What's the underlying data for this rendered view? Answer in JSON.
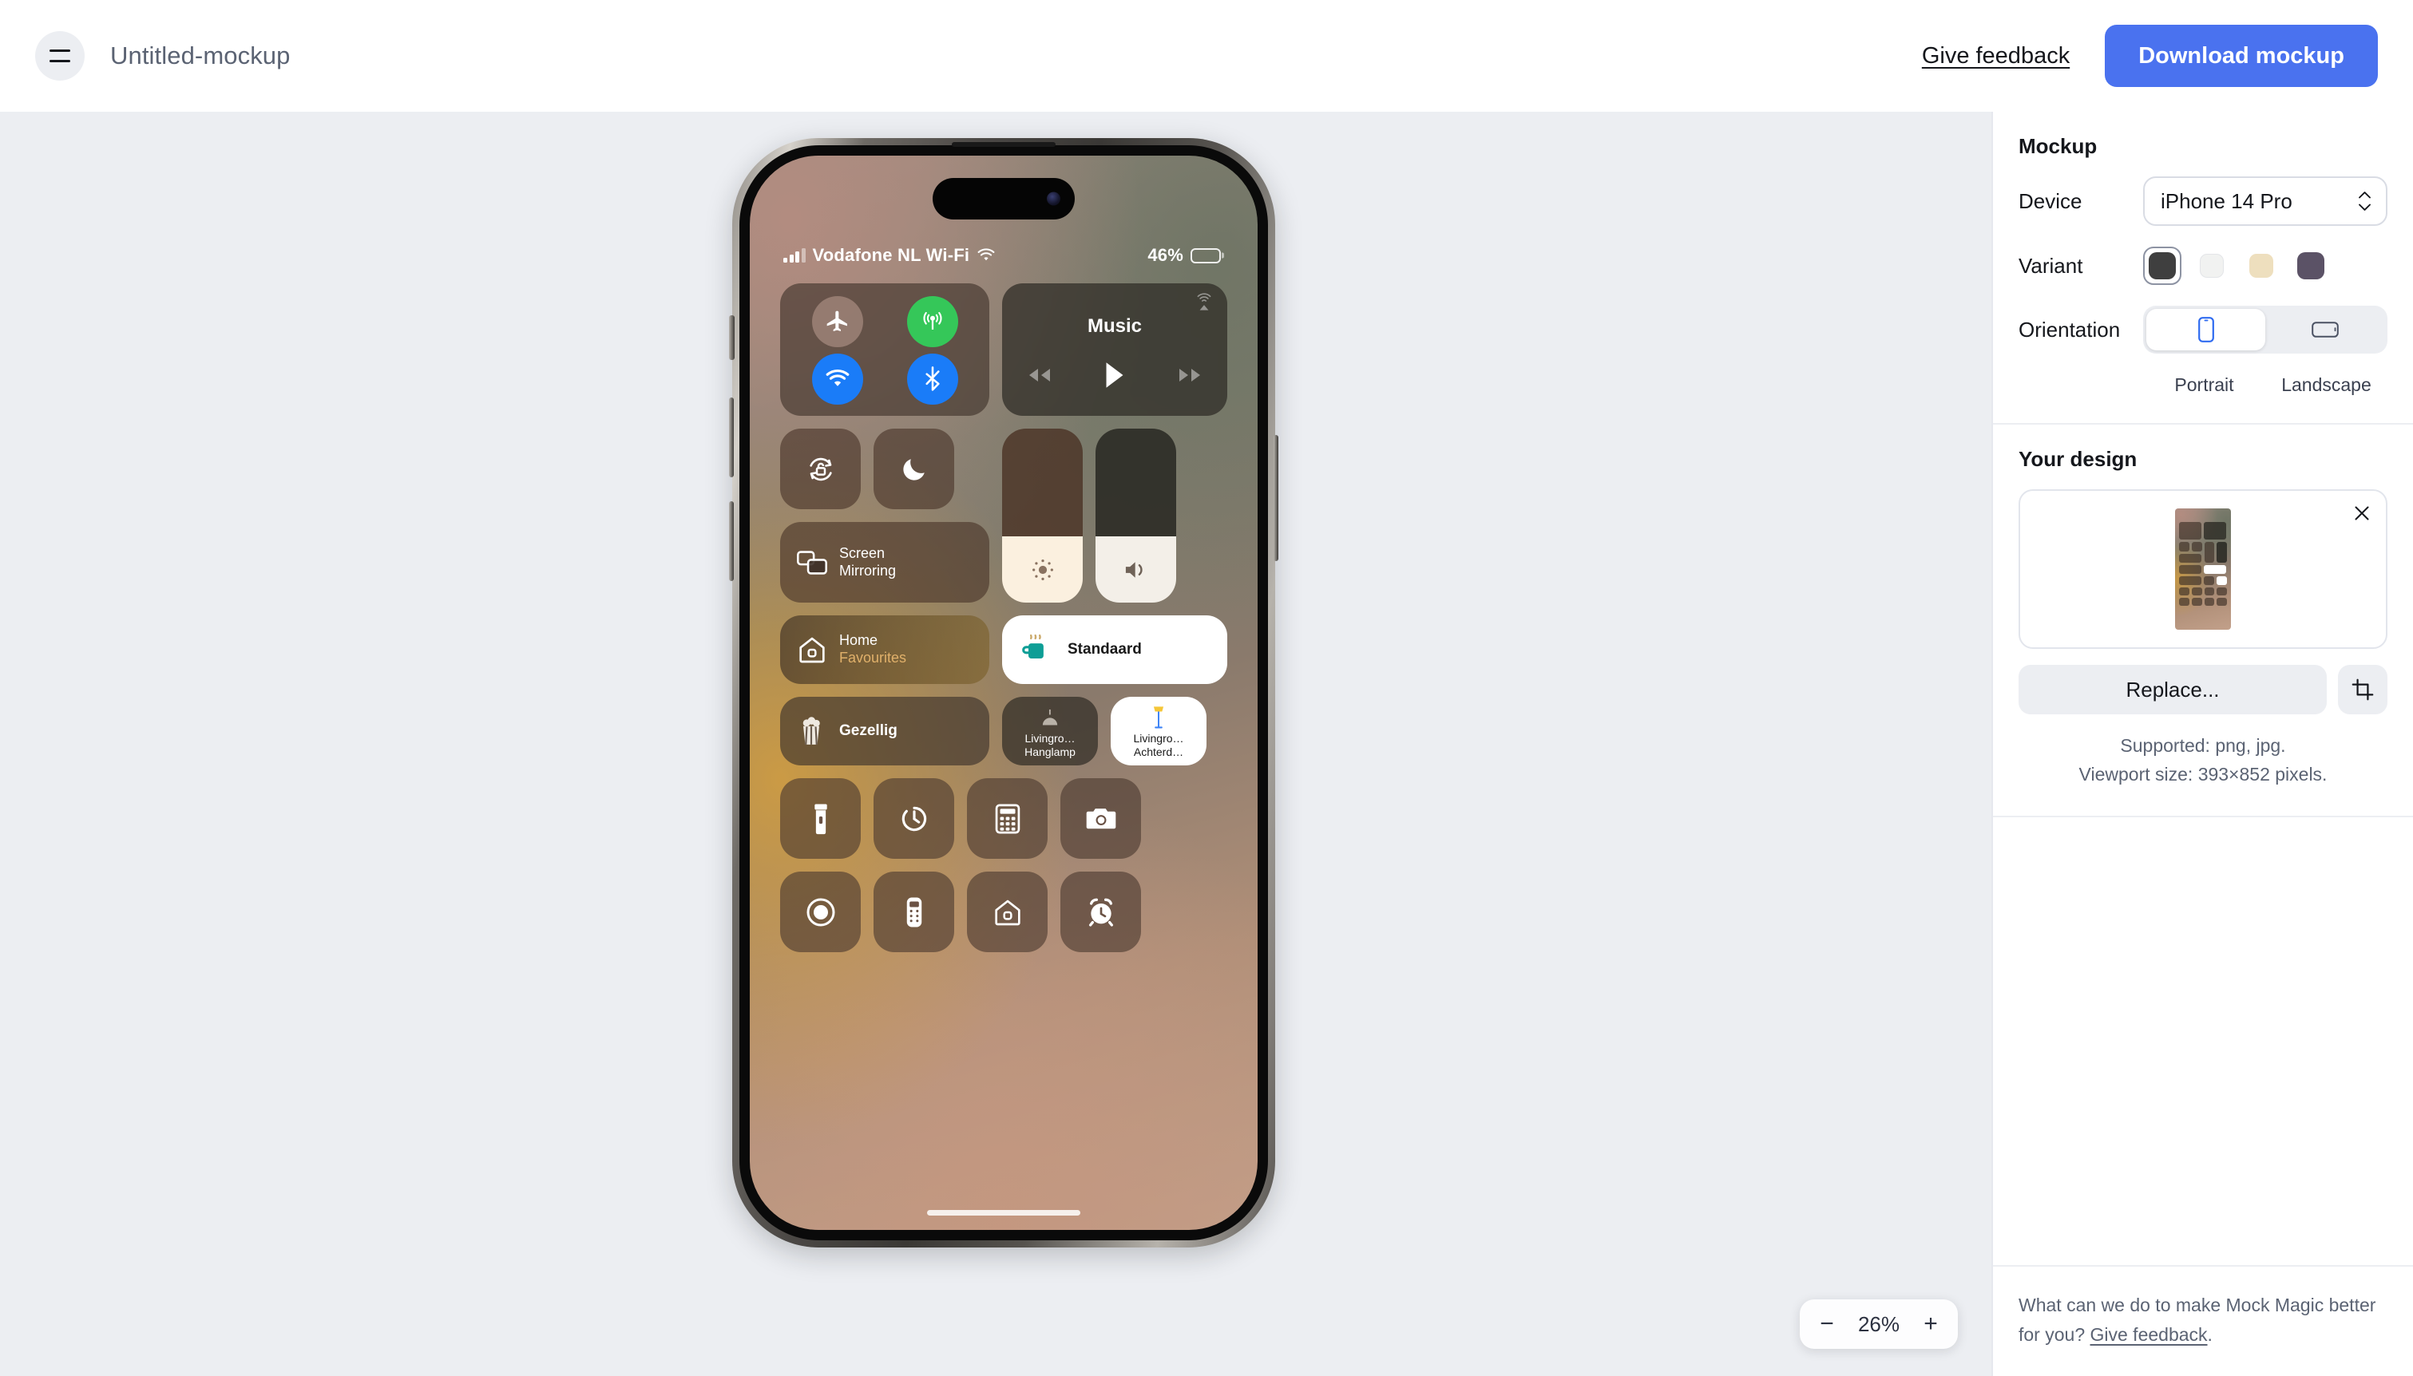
{
  "topbar": {
    "menu_icon": "hamburger-menu-icon",
    "document_title": "Untitled-mockup",
    "feedback_label": "Give feedback",
    "download_label": "Download mockup",
    "accent_color": "#4a72ef"
  },
  "canvas": {
    "background_color": "#eceef2",
    "zoom": {
      "minus_label": "−",
      "value": "26%",
      "plus_label": "+"
    }
  },
  "phone": {
    "status_bar": {
      "signal_icon": "cellular-bars-icon",
      "carrier": "Vodafone NL Wi-Fi",
      "wifi_icon": "wifi-icon",
      "battery_percent": "46%",
      "battery_icon": "battery-icon"
    },
    "connectivity": [
      {
        "name": "airplane-mode-toggle",
        "icon": "airplane-icon",
        "state": "off",
        "color": "#b4968a"
      },
      {
        "name": "cellular-data-toggle",
        "icon": "cellular-antenna-icon",
        "state": "on",
        "color": "#35c759"
      },
      {
        "name": "wifi-toggle",
        "icon": "wifi-icon",
        "state": "on",
        "color": "#1a7cf8"
      },
      {
        "name": "bluetooth-toggle",
        "icon": "bluetooth-icon",
        "state": "on",
        "color": "#1a7cf8"
      }
    ],
    "music": {
      "title": "Music",
      "airplay_icon": "airplay-icon",
      "prev_icon": "rewind-icon",
      "play_icon": "play-icon",
      "next_icon": "fast-forward-icon"
    },
    "toggles": {
      "rotation_lock_icon": "rotation-lock-icon",
      "focus_icon": "moon-icon",
      "screen_mirroring_line1": "Screen",
      "screen_mirroring_line2": "Mirroring",
      "screen_mirroring_icon": "screen-mirroring-icon"
    },
    "sliders": [
      {
        "name": "brightness-slider",
        "icon": "brightness-icon",
        "level_percent": 38
      },
      {
        "name": "volume-slider",
        "icon": "speaker-icon",
        "level_percent": 38
      }
    ],
    "home_tile": {
      "line1": "Home",
      "line2": "Favourites",
      "icon": "home-icon",
      "accent_color": "#e0b06a"
    },
    "scenes": [
      {
        "name": "standaard-scene",
        "label": "Standaard",
        "icon": "coffee-mug-icon",
        "style": "light"
      },
      {
        "name": "gezellig-scene",
        "label": "Gezellig",
        "icon": "popcorn-icon",
        "style": "dark"
      }
    ],
    "lamps": [
      {
        "name": "livingroom-hanglamp",
        "line1": "Livingro…",
        "line2": "Hanglamp",
        "icon": "pendant-lamp-icon",
        "style": "dark"
      },
      {
        "name": "livingroom-achterdeur",
        "line1": "Livingro…",
        "line2": "Achterd…",
        "icon": "floor-lamp-icon",
        "style": "light"
      }
    ],
    "quick_icons": [
      {
        "name": "flashlight-button",
        "icon": "flashlight-icon"
      },
      {
        "name": "timer-button",
        "icon": "timer-icon"
      },
      {
        "name": "calculator-button",
        "icon": "calculator-icon"
      },
      {
        "name": "camera-button",
        "icon": "camera-icon"
      },
      {
        "name": "screen-record-button",
        "icon": "record-circle-icon"
      },
      {
        "name": "remote-button",
        "icon": "apple-tv-remote-icon"
      },
      {
        "name": "home-button",
        "icon": "home-icon"
      },
      {
        "name": "alarm-button",
        "icon": "alarm-clock-icon"
      }
    ]
  },
  "sidebar": {
    "mockup": {
      "title": "Mockup",
      "device_label": "Device",
      "device_value": "iPhone 14 Pro",
      "device_options": [
        "iPhone 14 Pro"
      ],
      "variant_label": "Variant",
      "variants": [
        {
          "name": "variant-space-black",
          "color": "#3f3f3f",
          "selected": true
        },
        {
          "name": "variant-silver",
          "color": "#f1f2f1",
          "selected": false
        },
        {
          "name": "variant-gold",
          "color": "#eedfbe",
          "selected": false
        },
        {
          "name": "variant-deep-purple",
          "color": "#5b5266",
          "selected": false
        }
      ],
      "orientation_label": "Orientation",
      "orientation_options": [
        {
          "name": "orientation-portrait",
          "label": "Portrait",
          "icon": "phone-portrait-icon",
          "selected": true
        },
        {
          "name": "orientation-landscape",
          "label": "Landscape",
          "icon": "phone-landscape-icon",
          "selected": false
        }
      ]
    },
    "design": {
      "title": "Your design",
      "close_icon": "close-icon",
      "replace_label": "Replace...",
      "crop_icon": "crop-icon",
      "supported_text": "Supported: png, jpg.",
      "viewport_text": "Viewport size: 393×852 pixels."
    },
    "footer": {
      "question": "What can we do to make Mock Magic better for you? ",
      "link": "Give feedback",
      "period": "."
    }
  }
}
